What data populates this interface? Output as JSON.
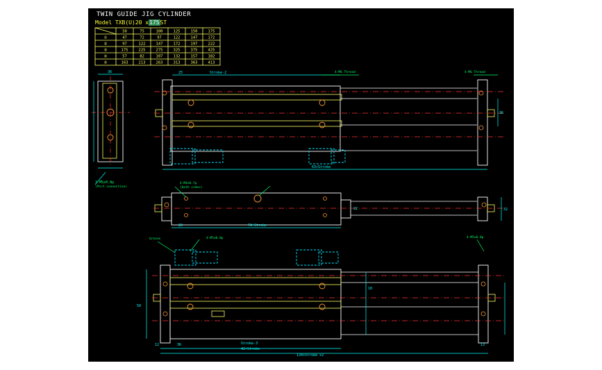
{
  "title": "TWIN GUIDE JIG CYLINDER",
  "model": {
    "prefix": "Model  TXB(U)20 x",
    "stroke": "175",
    "suffix": "ST"
  },
  "table": {
    "strokes": [
      "50",
      "75",
      "100",
      "125",
      "150",
      "175"
    ],
    "rows": [
      {
        "symbol": "①",
        "values": [
          "47",
          "72",
          "97",
          "122",
          "147",
          "172"
        ]
      },
      {
        "symbol": "②",
        "values": [
          "97",
          "122",
          "147",
          "172",
          "197",
          "222"
        ]
      },
      {
        "symbol": "③",
        "values": [
          "175",
          "225",
          "275",
          "325",
          "375",
          "425"
        ]
      },
      {
        "symbol": "④",
        "values": [
          "57",
          "82",
          "107",
          "132",
          "157",
          "182"
        ]
      },
      {
        "symbol": "⑤",
        "values": [
          "163",
          "213",
          "263",
          "313",
          "363",
          "413"
        ]
      }
    ]
  },
  "labels": {
    "top_stroke": "Stroke-2",
    "port_side": "3-M5x0.8p",
    "port_note": "(Port connection)",
    "dim_63_stroke": "63+Stroke",
    "rod_screw": "4-M6 Thread",
    "mid_tap": "4-M4x0.7p",
    "tap_note": "(both sides)",
    "mid_len": "74+Stroke",
    "bot_len_a": "Stroke-3",
    "bot_len_b": "42+Stroke",
    "bot_total": "134+Stroke x2",
    "bot_left": "4-M5x0.8p",
    "bot_right": "4-M5x0.8p",
    "groove": "Groove",
    "dim_36": "36",
    "dim_25": "25",
    "dim_20": "20",
    "dim_13": "13",
    "dim_10": "10",
    "dim_22": "22",
    "dim_32": "32",
    "dim_50": "50",
    "dim_12": "12"
  },
  "colors": {
    "background": "#000000",
    "outline": "#ffffff",
    "body": "#ffff66",
    "dimension": "#00ffff",
    "centerline": "#ff3333",
    "fitting": "#00e5ff",
    "hole": "#ff9933",
    "label": "#00ff66"
  }
}
